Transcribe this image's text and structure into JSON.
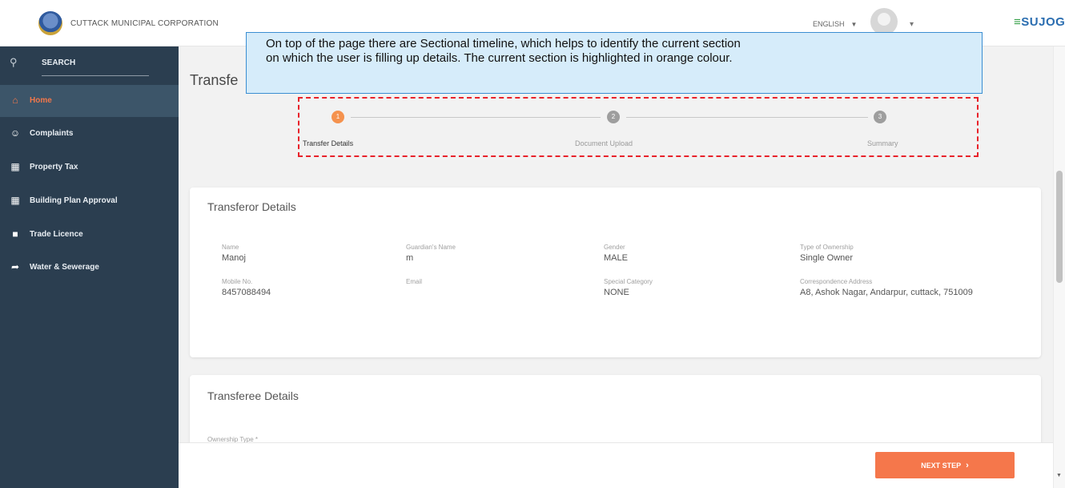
{
  "header": {
    "org_name": "CUTTACK MUNICIPAL CORPORATION",
    "language": "ENGLISH",
    "brand": "SUJOG"
  },
  "sidebar": {
    "search_label": "SEARCH",
    "items": [
      {
        "label": "Home",
        "icon": "home-icon",
        "active": true
      },
      {
        "label": "Complaints",
        "icon": "complaints-icon"
      },
      {
        "label": "Property Tax",
        "icon": "property-tax-icon"
      },
      {
        "label": "Building Plan Approval",
        "icon": "building-icon"
      },
      {
        "label": "Trade Licence",
        "icon": "trade-licence-icon"
      },
      {
        "label": "Water & Sewerage",
        "icon": "water-icon"
      }
    ]
  },
  "main": {
    "page_title": "Transfe",
    "stepper": {
      "steps": [
        {
          "label": "Transfer Details",
          "number": "1",
          "active": true
        },
        {
          "label": "Document Upload",
          "number": "2"
        },
        {
          "label": "Summary",
          "number": "3"
        }
      ]
    },
    "transferor": {
      "title": "Transferor Details",
      "fields": [
        {
          "label": "Name",
          "value": "Manoj"
        },
        {
          "label": "Guardian's Name",
          "value": "m"
        },
        {
          "label": "Gender",
          "value": "MALE"
        },
        {
          "label": "Type of Ownership",
          "value": "Single Owner"
        },
        {
          "label": "Mobile No.",
          "value": "8457088494"
        },
        {
          "label": "Email",
          "value": ""
        },
        {
          "label": "Special Category",
          "value": "NONE"
        },
        {
          "label": "Correspondence Address",
          "value": "A8, Ashok Nagar, Andarpur, cuttack, 751009"
        }
      ]
    },
    "transferee": {
      "title": "Transferee Details",
      "ownership_label": "Ownership Type *"
    }
  },
  "footer": {
    "next_button": "NEXT STEP"
  },
  "callout": {
    "line1": "On top of the page there are Sectional timeline, which helps to identify the current section",
    "line2": "on which the user is filling up details. The current section is highlighted in orange colour."
  },
  "colors": {
    "sidebar_bg": "#2b3e50",
    "accent": "#f5774b",
    "callout_bg": "#d6ecfa",
    "highlight_border": "#e8222a"
  }
}
